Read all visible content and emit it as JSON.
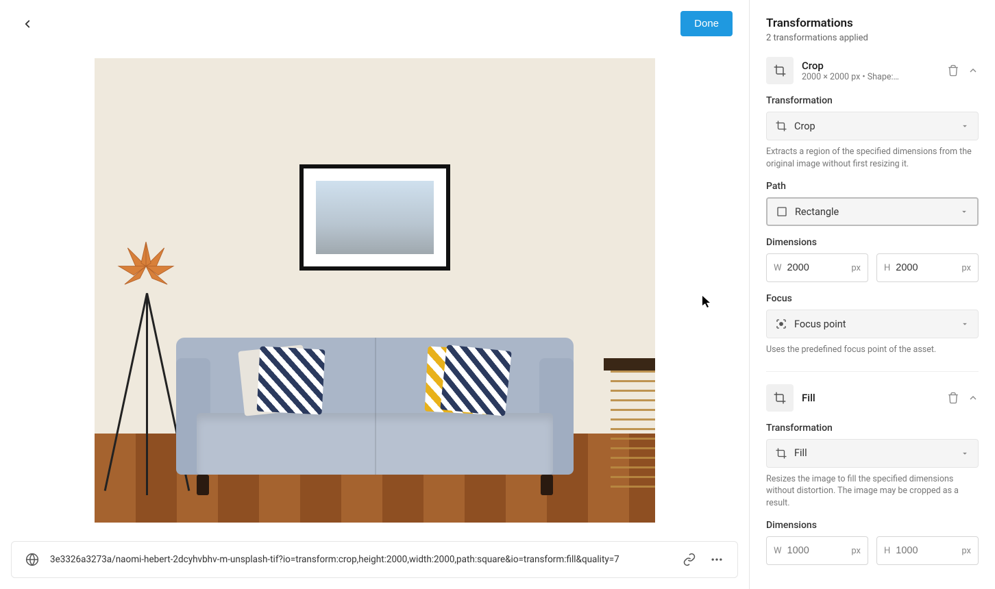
{
  "header": {
    "done_label": "Done"
  },
  "sidebar": {
    "title": "Transformations",
    "subtitle": "2 transformations applied",
    "blocks": [
      {
        "name": "Crop",
        "detail": "2000 × 2000 px • Shape:…",
        "transformation_label": "Transformation",
        "transformation_value": "Crop",
        "transformation_help": "Extracts a region of the specified dimensions from the original image without first resizing it.",
        "path_label": "Path",
        "path_value": "Rectangle",
        "dimensions_label": "Dimensions",
        "width_value": "2000",
        "height_value": "2000",
        "focus_label": "Focus",
        "focus_value": "Focus point",
        "focus_help": "Uses the predefined focus point of the asset."
      },
      {
        "name": "Fill",
        "detail": "",
        "transformation_label": "Transformation",
        "transformation_value": "Fill",
        "transformation_help": "Resizes the image to fill the specified dimensions without distortion. The image may be cropped as a result.",
        "dimensions_label": "Dimensions",
        "width_placeholder": "1000",
        "height_placeholder": "1000"
      }
    ],
    "dim_prefix_w": "W",
    "dim_prefix_h": "H",
    "dim_unit": "px"
  },
  "bottom": {
    "url": "3e3326a3273a/naomi-hebert-2dcyhvbhv-m-unsplash-tif?io=transform:crop,height:2000,width:2000,path:square&io=transform:fill&quality=7"
  }
}
